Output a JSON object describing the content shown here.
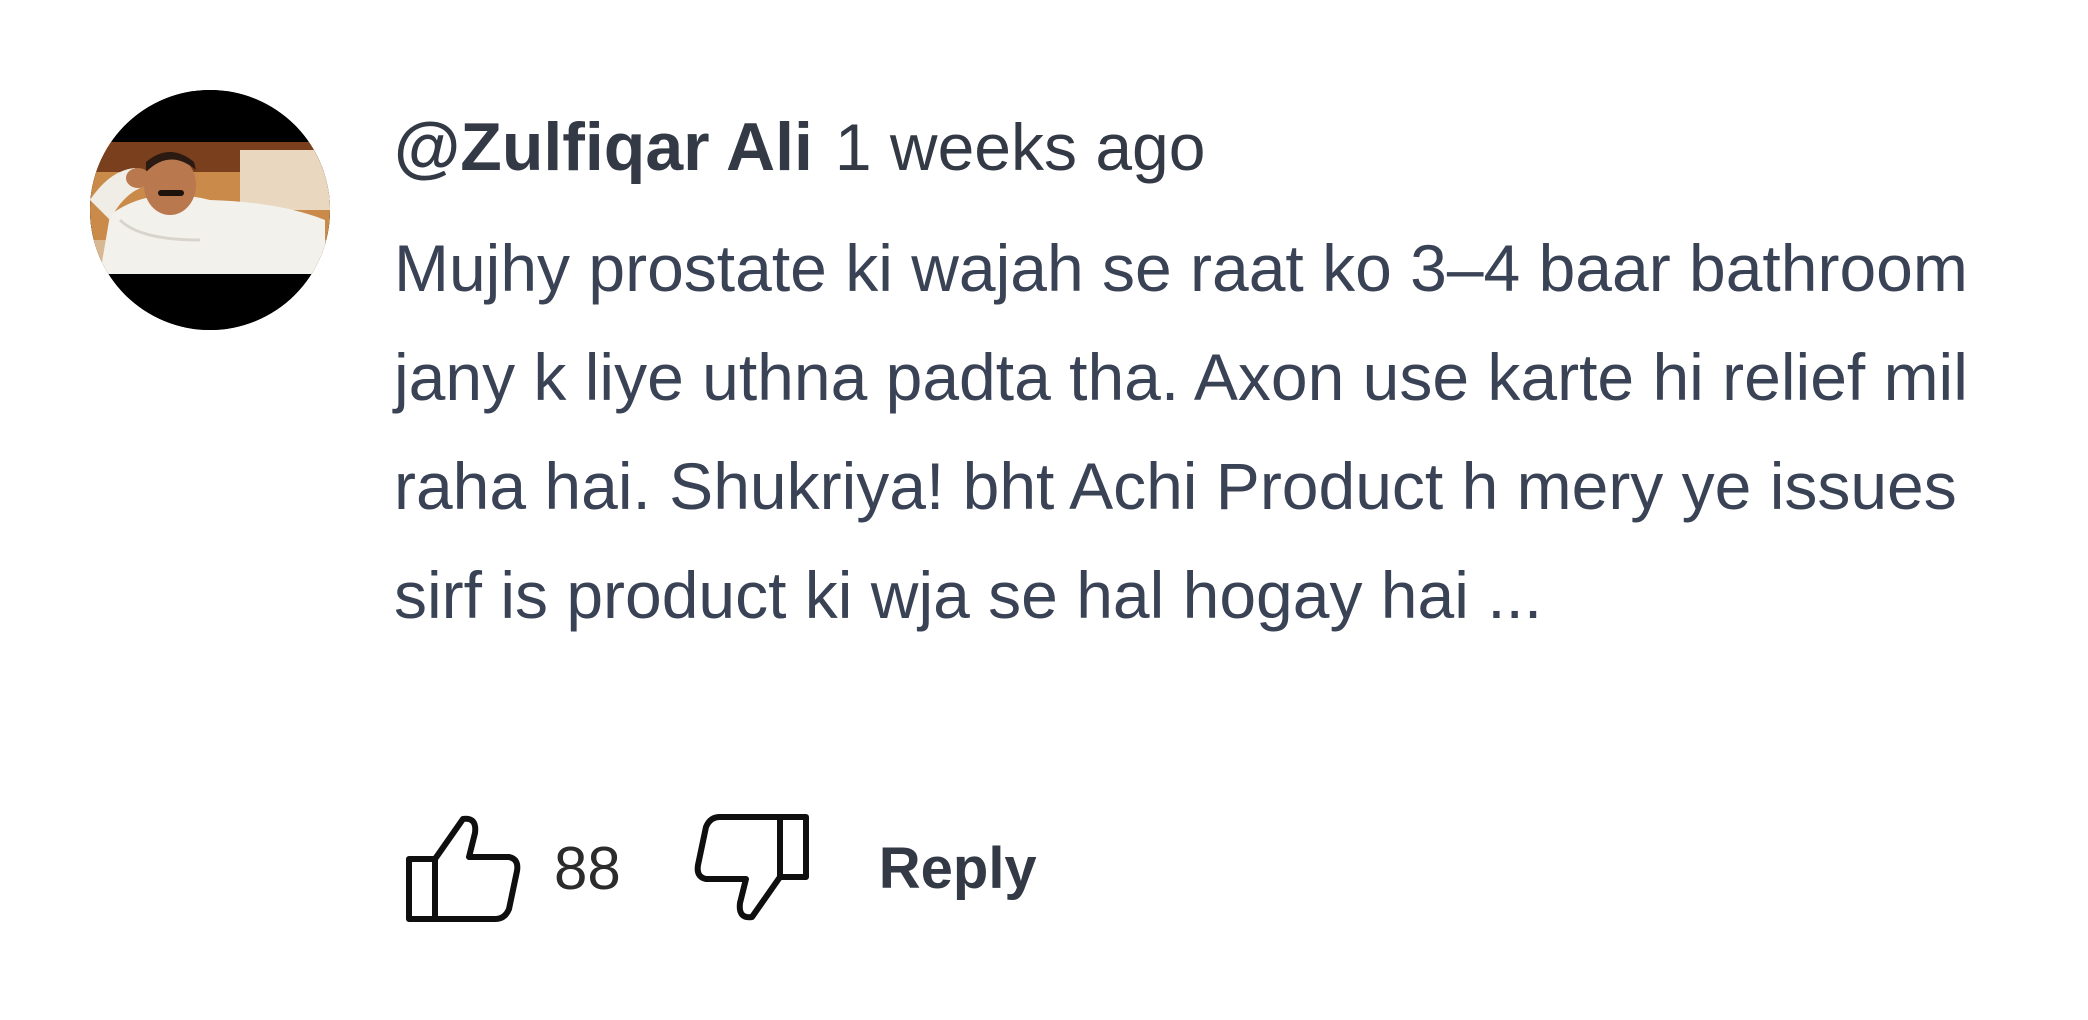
{
  "comment": {
    "author": "@Zulfiqar Ali",
    "timestamp": "1 weeks ago",
    "text": "Mujhy prostate ki wajah se raat ko 3–4 baar bathroom jany k liye uthna padta tha. Axon use karte hi relief mil raha hai. Shukriya! bht Achi Product h mery ye issues sirf is product ki wja se hal hogay hai ...",
    "like_count": "88",
    "reply_label": "Reply",
    "icons": {
      "like": "thumbs-up-icon",
      "dislike": "thumbs-down-icon",
      "avatar": "user-avatar"
    },
    "colors": {
      "text": "#3a4355",
      "author": "#333a45",
      "background": "#ffffff"
    }
  }
}
